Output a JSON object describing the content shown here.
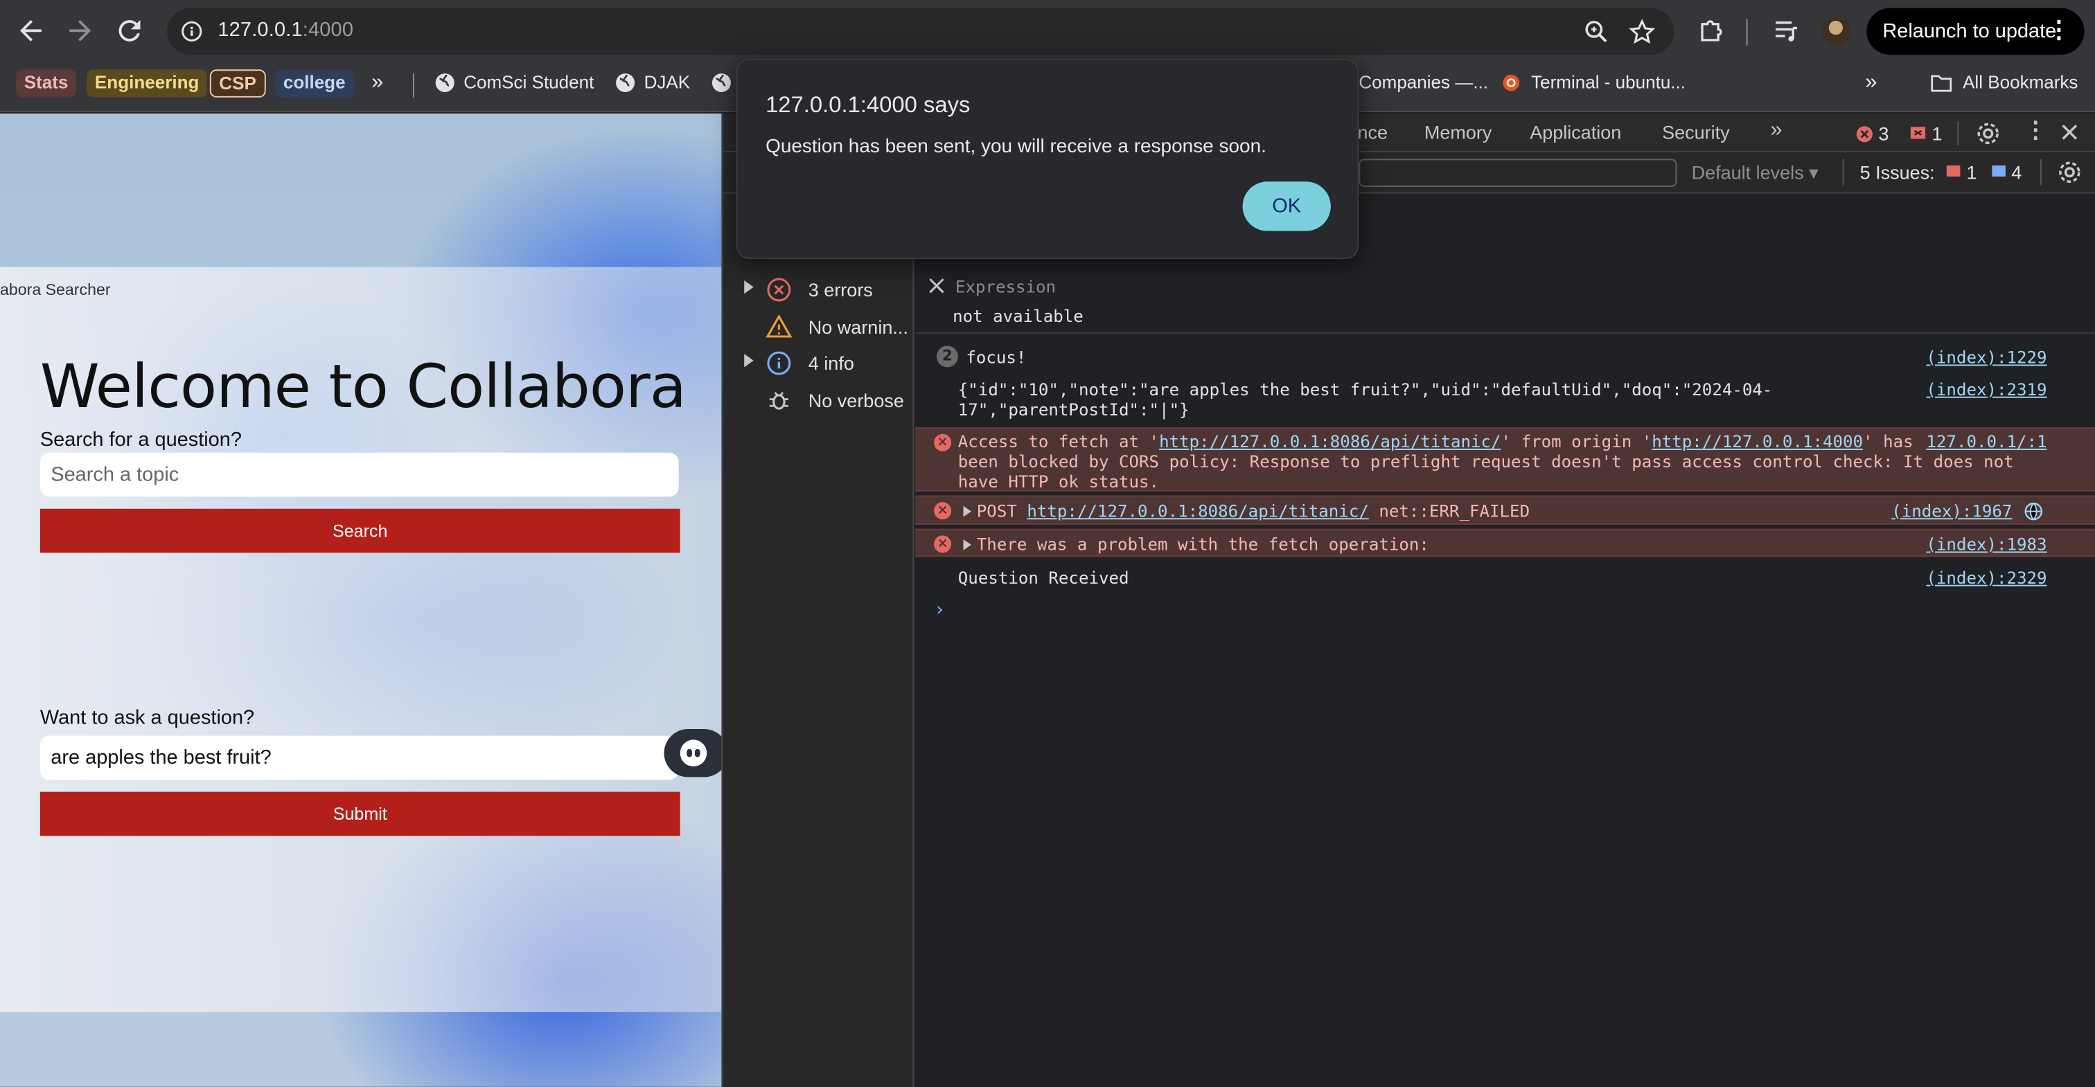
{
  "browser": {
    "url_host": "127.0.0.1",
    "url_port": ":4000",
    "relaunch_label": "Relaunch to update",
    "menu_glyph": "⋮",
    "more_glyph": "»"
  },
  "bookmarks": {
    "chips": [
      {
        "label": "Stats",
        "bg": "#5a3a3a",
        "fg": "#f2b8b5"
      },
      {
        "label": "Engineering",
        "bg": "#5a4a20",
        "fg": "#f8d98a"
      },
      {
        "label": "CSP",
        "bg": "#4a3220",
        "fg": "#f3c9a5"
      },
      {
        "label": "college",
        "bg": "#2f3e5a",
        "fg": "#c2d7f5"
      }
    ],
    "links": [
      "ComSci Student",
      "DJAK",
      "Companies —...",
      "Terminal - ubuntu..."
    ],
    "all_bookmarks": "All Bookmarks"
  },
  "page": {
    "site_name": "abora Searcher",
    "title": "Welcome to Collabora",
    "search_label": "Search for a question?",
    "search_placeholder": "Search a topic",
    "search_button": "Search",
    "ask_label": "Want to ask a question?",
    "ask_value": "are apples the best fruit?",
    "submit_button": "Submit"
  },
  "devtools": {
    "tabs": [
      "nce",
      "Memory",
      "Application",
      "Security"
    ],
    "error_count": "3",
    "warning_count": "1",
    "levels_label": "Default levels",
    "issues_label": "5 Issues:",
    "issues_errors": "1",
    "issues_info": "4",
    "sidebar": [
      {
        "label": "3 errors",
        "icon": "error-circle-icon",
        "expandable": true
      },
      {
        "label": "No warnin...",
        "icon": "warning-triangle-icon",
        "expandable": false
      },
      {
        "label": "4 info",
        "icon": "info-circle-icon",
        "expandable": true
      },
      {
        "label": "No verbose",
        "icon": "bug-icon",
        "expandable": false
      }
    ],
    "expression_label": "Expression",
    "expression_value": "not available",
    "messages": {
      "focus_count": "2",
      "focus_text": "focus!",
      "focus_src": "(index):1229",
      "json_line1": "{\"id\":\"10\",\"note\":\"are apples the best fruit?\",\"uid\":\"defaultUid\",\"doq\":\"2024-04-",
      "json_line2": "17\",\"parentPostId\":\"|\"}",
      "json_src": "(index):2319",
      "cors_pre": "Access to fetch at '",
      "cors_url1": "http://127.0.0.1:8086/api/titanic/",
      "cors_mid": "' from origin '",
      "cors_url2": "http://127.0.0.1:4000",
      "cors_post": "' has ",
      "cors_src": "127.0.0.1/:1",
      "cors_line2": "been blocked by CORS policy: Response to preflight request doesn't pass access control check: It does not",
      "cors_line3": "have HTTP ok status.",
      "post_method": "POST",
      "post_url": "http://127.0.0.1:8086/api/titanic/",
      "post_err": "net::ERR_FAILED",
      "post_src": "(index):1967",
      "problem_text": "There was a problem with the fetch operation:",
      "problem_src": "(index):1983",
      "received_text": "Question Received",
      "received_src": "(index):2329"
    }
  },
  "dialog": {
    "title": "127.0.0.1:4000 says",
    "message": "Question has been sent, you will receive a response soon.",
    "ok_label": "OK"
  },
  "colors": {
    "accent_red": "#b32019",
    "ok_button": "#7cd0de",
    "devtools_bg": "#282828"
  }
}
